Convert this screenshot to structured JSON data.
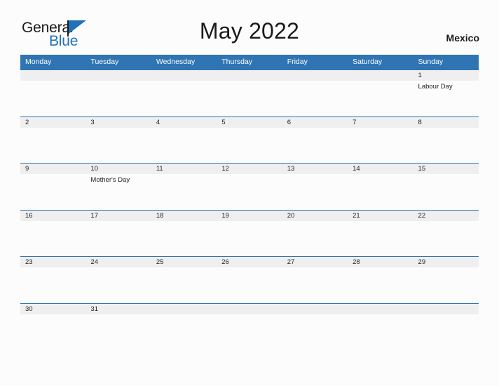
{
  "brand": {
    "word_general": "General",
    "word_blue": "Blue",
    "pole_icon": "flag-pole-icon",
    "flag_icon": "blue-triangle-flag-icon"
  },
  "header": {
    "month_title": "May 2022",
    "region": "Mexico"
  },
  "calendar": {
    "weekdays": [
      "Monday",
      "Tuesday",
      "Wednesday",
      "Thursday",
      "Friday",
      "Saturday",
      "Sunday"
    ],
    "weeks": [
      {
        "dates": [
          "",
          "",
          "",
          "",
          "",
          "",
          "1"
        ],
        "events": [
          "",
          "",
          "",
          "",
          "",
          "",
          "Labour Day"
        ]
      },
      {
        "dates": [
          "2",
          "3",
          "4",
          "5",
          "6",
          "7",
          "8"
        ],
        "events": [
          "",
          "",
          "",
          "",
          "",
          "",
          ""
        ]
      },
      {
        "dates": [
          "9",
          "10",
          "11",
          "12",
          "13",
          "14",
          "15"
        ],
        "events": [
          "",
          "Mother's Day",
          "",
          "",
          "",
          "",
          ""
        ]
      },
      {
        "dates": [
          "16",
          "17",
          "18",
          "19",
          "20",
          "21",
          "22"
        ],
        "events": [
          "",
          "",
          "",
          "",
          "",
          "",
          ""
        ]
      },
      {
        "dates": [
          "23",
          "24",
          "25",
          "26",
          "27",
          "28",
          "29"
        ],
        "events": [
          "",
          "",
          "",
          "",
          "",
          "",
          ""
        ]
      },
      {
        "dates": [
          "30",
          "31",
          "",
          "",
          "",
          "",
          ""
        ],
        "events": [
          "",
          "",
          "",
          "",
          "",
          "",
          ""
        ]
      }
    ]
  },
  "colors": {
    "header_blue": "#2f74b3",
    "brand_blue": "#1f72b8",
    "date_band_gray": "#efefef",
    "page_background": "#fcfcfc",
    "text_dark": "#1b1b1b"
  }
}
